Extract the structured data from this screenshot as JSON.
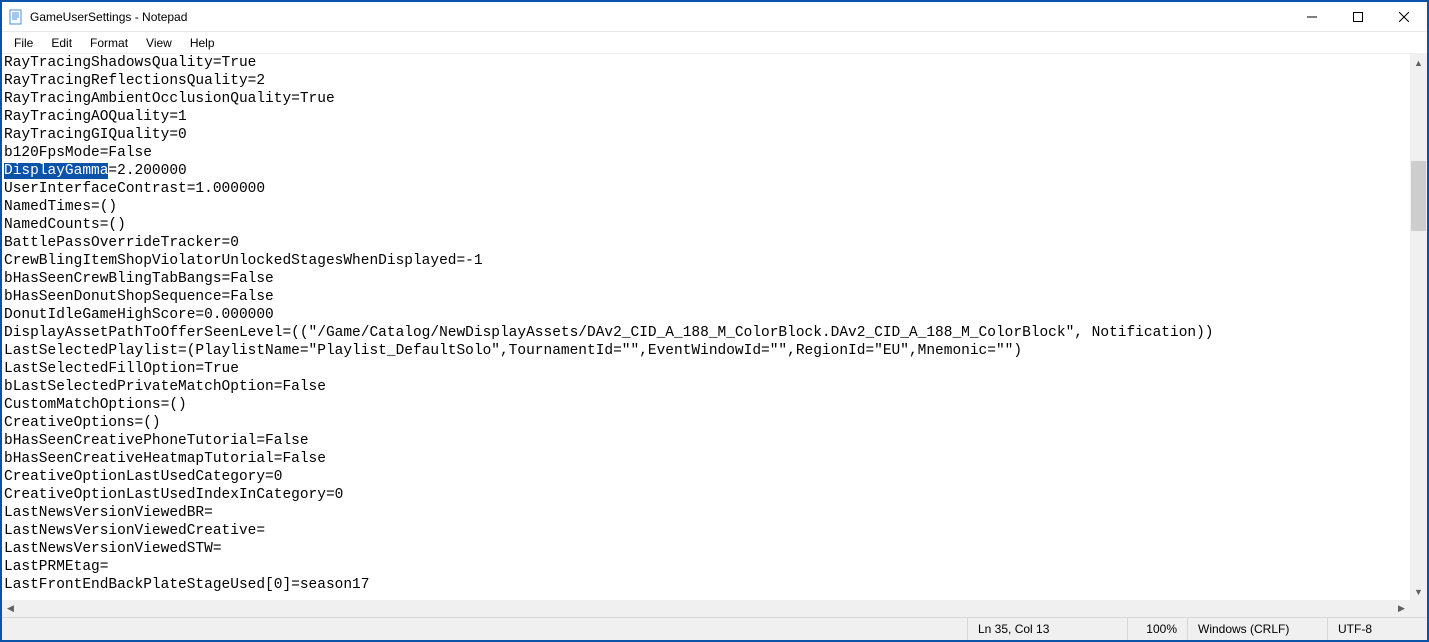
{
  "window": {
    "title": "GameUserSettings - Notepad"
  },
  "menu": {
    "file": "File",
    "edit": "Edit",
    "format": "Format",
    "view": "View",
    "help": "Help"
  },
  "selection": {
    "line_index": 6,
    "start": 0,
    "end": 12
  },
  "lines": [
    "RayTracingShadowsQuality=True",
    "RayTracingReflectionsQuality=2",
    "RayTracingAmbientOcclusionQuality=True",
    "RayTracingAOQuality=1",
    "RayTracingGIQuality=0",
    "b120FpsMode=False",
    "DisplayGamma=2.200000",
    "UserInterfaceContrast=1.000000",
    "NamedTimes=()",
    "NamedCounts=()",
    "BattlePassOverrideTracker=0",
    "CrewBlingItemShopViolatorUnlockedStagesWhenDisplayed=-1",
    "bHasSeenCrewBlingTabBangs=False",
    "bHasSeenDonutShopSequence=False",
    "DonutIdleGameHighScore=0.000000",
    "DisplayAssetPathToOfferSeenLevel=((\"/Game/Catalog/NewDisplayAssets/DAv2_CID_A_188_M_ColorBlock.DAv2_CID_A_188_M_ColorBlock\", Notification))",
    "LastSelectedPlaylist=(PlaylistName=\"Playlist_DefaultSolo\",TournamentId=\"\",EventWindowId=\"\",RegionId=\"EU\",Mnemonic=\"\")",
    "LastSelectedFillOption=True",
    "bLastSelectedPrivateMatchOption=False",
    "CustomMatchOptions=()",
    "CreativeOptions=()",
    "bHasSeenCreativePhoneTutorial=False",
    "bHasSeenCreativeHeatmapTutorial=False",
    "CreativeOptionLastUsedCategory=0",
    "CreativeOptionLastUsedIndexInCategory=0",
    "LastNewsVersionViewedBR=",
    "LastNewsVersionViewedCreative=",
    "LastNewsVersionViewedSTW=",
    "LastPRMEtag=",
    "LastFrontEndBackPlateStageUsed[0]=season17"
  ],
  "status": {
    "position": "Ln 35, Col 13",
    "zoom": "100%",
    "eol": "Windows (CRLF)",
    "encoding": "UTF-8"
  }
}
